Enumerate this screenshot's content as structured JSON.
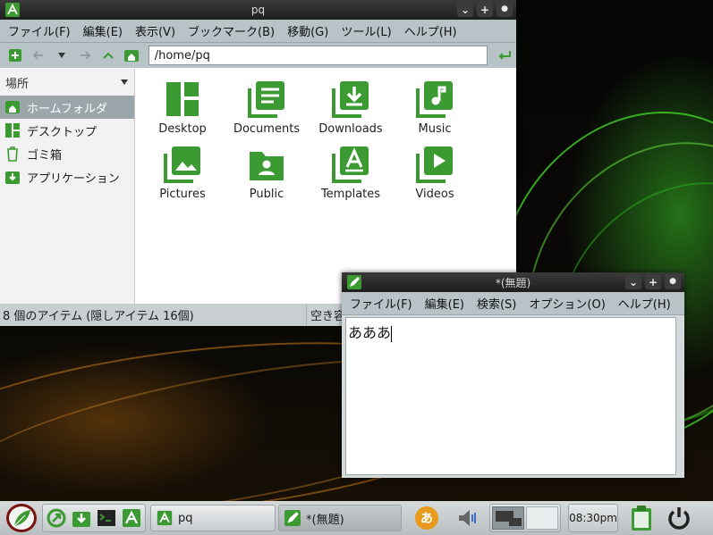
{
  "file_manager": {
    "title": "pq",
    "menu": [
      "ファイル(F)",
      "編集(E)",
      "表示(V)",
      "ブックマーク(B)",
      "移動(G)",
      "ツール(L)",
      "ヘルプ(H)"
    ],
    "path": "/home/pq",
    "side_header": "場所",
    "places": [
      {
        "label": "ホームフォルダ",
        "icon": "home-icon"
      },
      {
        "label": "デスクトップ",
        "icon": "desktop-icon"
      },
      {
        "label": "ゴミ箱",
        "icon": "trash-icon"
      },
      {
        "label": "アプリケーション",
        "icon": "applications-icon"
      }
    ],
    "items": [
      {
        "label": "Desktop",
        "icon": "desktop-folder-icon"
      },
      {
        "label": "Documents",
        "icon": "documents-folder-icon"
      },
      {
        "label": "Downloads",
        "icon": "downloads-folder-icon"
      },
      {
        "label": "Music",
        "icon": "music-folder-icon"
      },
      {
        "label": "Pictures",
        "icon": "pictures-folder-icon"
      },
      {
        "label": "Public",
        "icon": "public-folder-icon"
      },
      {
        "label": "Templates",
        "icon": "templates-folder-icon"
      },
      {
        "label": "Videos",
        "icon": "videos-folder-icon"
      }
    ],
    "status_left": "8 個のアイテム (隠しアイテム 16個)",
    "status_right": "空き容"
  },
  "editor": {
    "title": "*(無題)",
    "menu": [
      "ファイル(F)",
      "編集(E)",
      "検索(S)",
      "オプション(O)",
      "ヘルプ(H)"
    ],
    "content": "あああ"
  },
  "window_buttons": {
    "shade": "⌄",
    "maximize": "+",
    "close": "●"
  },
  "taskbar": {
    "tasks": [
      {
        "label": "pq"
      },
      {
        "label": "*(無題)"
      }
    ],
    "ime_label": "あ",
    "clock": "08:30pm"
  },
  "colors": {
    "accent": "#3c9a32",
    "menubar": "#b7c3c7",
    "selection": "#9aa6aa"
  }
}
